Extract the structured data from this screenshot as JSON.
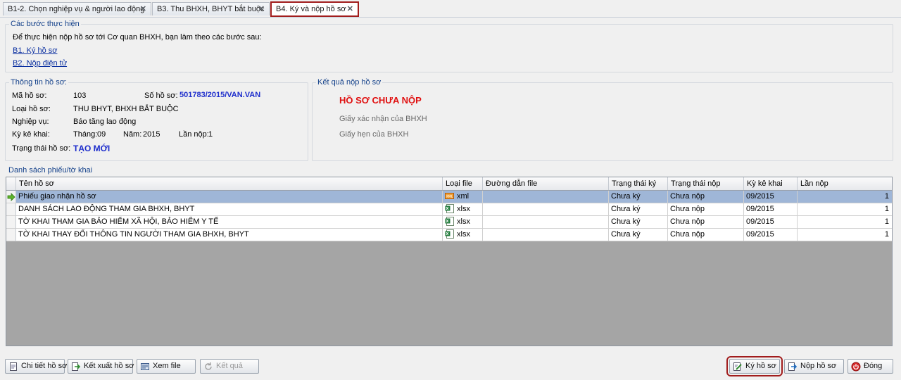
{
  "tabs": [
    {
      "label": "B1-2. Chọn nghiệp vụ & người lao động"
    },
    {
      "label": "B3. Thu BHXH, BHYT bắt buộc"
    },
    {
      "label": "B4. Ký và nộp hồ sơ"
    }
  ],
  "steps": {
    "title": "Các bước thực hiện",
    "intro": "Để thực hiện nộp hồ sơ tới Cơ quan BHXH, bạn làm theo các bước sau:",
    "step1": "B1. Ký hồ sơ",
    "step2": "B2. Nộp điện tử"
  },
  "info": {
    "title": "Thông tin hồ sơ:",
    "ma_label": "Mã hồ sơ:",
    "ma_value": "103",
    "so_label": "Số hồ sơ:",
    "so_value": "501783/2015/VAN.VAN",
    "loai_label": "Loại hồ sơ:",
    "loai_value": "THU BHYT, BHXH BẮT BUỘC",
    "nghiepvu_label": "Nghiệp vụ:",
    "nghiepvu_value": "Báo tăng lao động",
    "kykhai_label": "Kỳ kê khai:",
    "thang_label": "Tháng:",
    "thang_value": "09",
    "nam_label": "Năm:",
    "nam_value": "2015",
    "lannop_label": "Lần nộp:",
    "lannop_value": "1",
    "trangthai_label": "Trạng thái hồ sơ:",
    "trangthai_value": "TẠO MỚI"
  },
  "result": {
    "title": "Kết quả nộp hồ sơ",
    "status": "HỒ SƠ CHƯA NỘP",
    "xacnhan": "Giấy xác nhận của BHXH",
    "hen": "Giấy hẹn của BHXH"
  },
  "grid": {
    "title": "Danh sách phiếu/tờ khai",
    "headers": [
      "Tên hồ sơ",
      "Loại file",
      "Đường dẫn file",
      "Trạng thái ký",
      "Trạng thái nộp",
      "Kỳ kê khai",
      "Lần nộp"
    ],
    "rows": [
      {
        "name": "Phiếu giao nhận hồ sơ",
        "type": "xml",
        "path": "",
        "sign": "Chưa ký",
        "submit": "Chưa nộp",
        "period": "09/2015",
        "count": "1"
      },
      {
        "name": "DANH SÁCH LAO ĐỘNG THAM GIA BHXH, BHYT",
        "type": "xlsx",
        "path": "",
        "sign": "Chưa ký",
        "submit": "Chưa nộp",
        "period": "09/2015",
        "count": "1"
      },
      {
        "name": "TỜ KHAI THAM GIA BẢO HIỂM XÃ HỘI, BẢO HIỂM Y TẾ",
        "type": "xlsx",
        "path": "",
        "sign": "Chưa ký",
        "submit": "Chưa nộp",
        "period": "09/2015",
        "count": "1"
      },
      {
        "name": "TỜ KHAI THAY ĐỔI THÔNG TIN NGƯỜI THAM GIA BHXH, BHYT",
        "type": "xlsx",
        "path": "",
        "sign": "Chưa ký",
        "submit": "Chưa nộp",
        "period": "09/2015",
        "count": "1"
      }
    ]
  },
  "buttons": {
    "chitiet": "Chi tiết hồ sơ",
    "ketxuat": "Kết xuất hồ sơ",
    "xemfile": "Xem file",
    "ketqua": "Kết quả",
    "kyhoso": "Ký hồ sơ",
    "nophoso": "Nộp hồ sơ",
    "dong": "Đóng"
  },
  "colors": {
    "accent": "#a11d1d",
    "link": "#0a2fa0",
    "status_red": "#e01010",
    "selected_row": "#9fb6d7"
  }
}
